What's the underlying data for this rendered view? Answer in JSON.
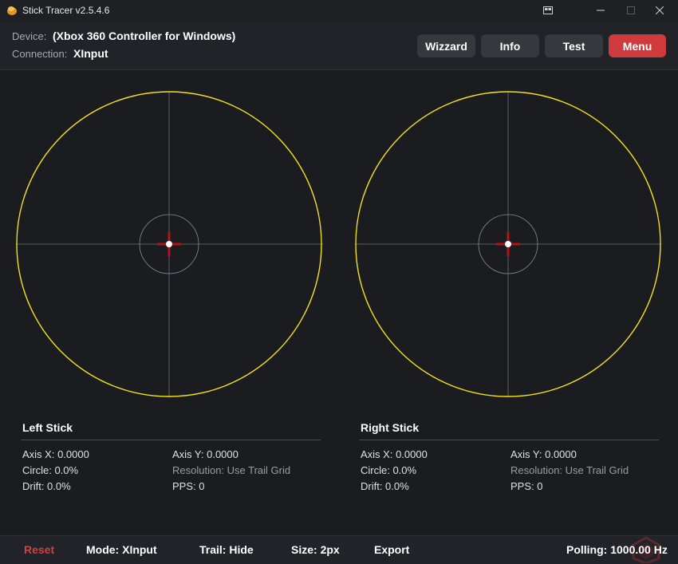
{
  "window": {
    "title": "Stick Tracer v2.5.4.6"
  },
  "header": {
    "device_label": "Device:",
    "device_value": "(Xbox 360 Controller for Windows)",
    "connection_label": "Connection:",
    "connection_value": "XInput",
    "buttons": {
      "wizzard": "Wizzard",
      "info": "Info",
      "test": "Test",
      "menu": "Menu"
    }
  },
  "left": {
    "title": "Left Stick",
    "axis_x": "Axis X: 0.0000",
    "axis_y": "Axis Y: 0.0000",
    "circle": "Circle: 0.0%",
    "resolution": "Resolution: Use Trail Grid",
    "drift": "Drift: 0.0%",
    "pps": "PPS: 0"
  },
  "right": {
    "title": "Right Stick",
    "axis_x": "Axis X: 0.0000",
    "axis_y": "Axis Y: 0.0000",
    "circle": "Circle: 0.0%",
    "resolution": "Resolution: Use Trail Grid",
    "drift": "Drift: 0.0%",
    "pps": "PPS: 0"
  },
  "footer": {
    "reset": "Reset",
    "mode": "Mode: XInput",
    "trail": "Trail: Hide",
    "size": "Size: 2px",
    "export": "Export",
    "polling": "Polling: 1000.00 Hz"
  },
  "colors": {
    "trace": "#f2e31b",
    "accent_red": "#cf3a3c",
    "crosshair": "#b3121b",
    "grid": "#6f7075",
    "background": "#1b1c20"
  }
}
